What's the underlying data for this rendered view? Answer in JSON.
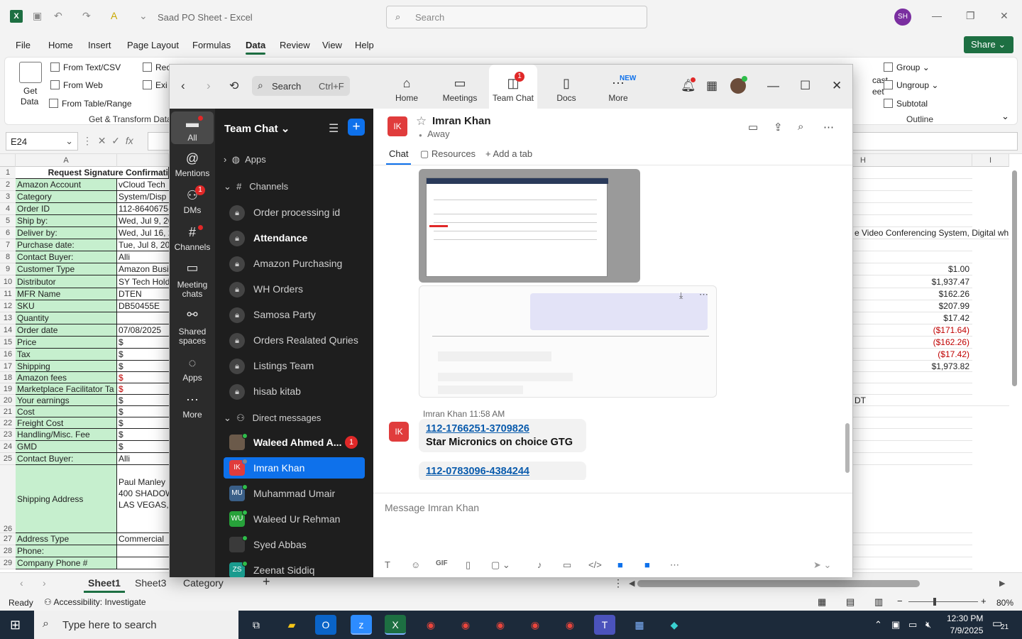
{
  "excel": {
    "title": "Saad PO Sheet  -  Excel",
    "search_placeholder": "Search",
    "user_initials": "SH",
    "menus": [
      "File",
      "Home",
      "Insert",
      "Page Layout",
      "Formulas",
      "Data",
      "Review",
      "View",
      "Help"
    ],
    "active_menu": "Data",
    "share_label": "Share",
    "ribbon": {
      "get_data": "Get",
      "get_data2": "Data",
      "from_text_csv": "From Text/CSV",
      "from_web": "From Web",
      "from_table_range": "From Table/Range",
      "group_label": "Get & Transform Data",
      "rec": "Rec",
      "exi": "Exi",
      "group": "Group",
      "ungroup": "Ungroup",
      "subtotal": "Subtotal",
      "outline": "Outline",
      "cast": "cast",
      "eet": "eet"
    },
    "name_box": "E24",
    "columns": {
      "a": "A",
      "h": "H",
      "i": "I"
    },
    "rows": [
      {
        "n": "1",
        "a": "Request Signature Confirmati",
        "b": "",
        "h": ""
      },
      {
        "n": "2",
        "a": "Amazon Account",
        "b": "vCloud Tech",
        "h": ""
      },
      {
        "n": "3",
        "a": "Category",
        "b": "System/Disp",
        "h": ""
      },
      {
        "n": "4",
        "a": "Order ID",
        "b": "112-8640675-",
        "h": ""
      },
      {
        "n": "5",
        "a": "Ship by:",
        "b": "Wed, Jul 9, 20",
        "h": ""
      },
      {
        "n": "6",
        "a": "Deliver by:",
        "b": "Wed, Jul 16, 2",
        "h": "e Video Conferencing System, Digital wh"
      },
      {
        "n": "7",
        "a": "Purchase date:",
        "b": "Tue, Jul 8, 202",
        "h": ""
      },
      {
        "n": "8",
        "a": "Contact Buyer:",
        "b": "Alli",
        "h": ""
      },
      {
        "n": "9",
        "a": "Customer Type",
        "b": "Amazon Busi",
        "h": "$1.00"
      },
      {
        "n": "10",
        "a": "Distributor",
        "b": "SY Tech Hold",
        "h": "$1,937.47"
      },
      {
        "n": "11",
        "a": "MFR Name",
        "b": "DTEN",
        "h": "$162.26"
      },
      {
        "n": "12",
        "a": "SKU",
        "b": "DB50455E",
        "h": "$207.99"
      },
      {
        "n": "13",
        "a": "Quantity",
        "b": "",
        "h": "$17.42"
      },
      {
        "n": "14",
        "a": "Order date",
        "b": "07/08/2025",
        "h": "($171.64)"
      },
      {
        "n": "15",
        "a": "Price",
        "b": "$",
        "h": "($162.26)"
      },
      {
        "n": "16",
        "a": "Tax",
        "b": "$",
        "h": "($17.42)"
      },
      {
        "n": "17",
        "a": "Shipping",
        "b": "$",
        "h": "$1,973.82"
      },
      {
        "n": "18",
        "a": "Amazon fees",
        "b": "$",
        "h": ""
      },
      {
        "n": "19",
        "a": "Marketplace Facilitator Ta",
        "b": "$",
        "h": ""
      },
      {
        "n": "20",
        "a": "Your earnings",
        "b": "$",
        "h": "DT"
      },
      {
        "n": "21",
        "a": "Cost",
        "b": "$",
        "h": ""
      },
      {
        "n": "22",
        "a": "Freight Cost",
        "b": "$",
        "h": ""
      },
      {
        "n": "23",
        "a": "Handling/Misc. Fee",
        "b": "$",
        "h": ""
      },
      {
        "n": "24",
        "a": "GMD",
        "b": "$",
        "h": ""
      },
      {
        "n": "25",
        "a": "Contact Buyer:",
        "b": "Alli",
        "h": ""
      },
      {
        "n": "26",
        "a": "Shipping Address",
        "b": "Paul Manley\n400 SHADOW\nLAS VEGAS, N",
        "h": ""
      },
      {
        "n": "27",
        "a": "Address Type",
        "b": "Commercial",
        "h": ""
      },
      {
        "n": "28",
        "a": "Phone:",
        "b": "",
        "h": ""
      },
      {
        "n": "29",
        "a": "Company Phone #",
        "b": "",
        "h": ""
      }
    ],
    "sheets": [
      "Sheet1",
      "Sheet3",
      "Category"
    ],
    "active_sheet": "Sheet1",
    "status_ready": "Ready",
    "status_accessibility": "Accessibility: Investigate",
    "zoom_level": "80%"
  },
  "zoom": {
    "search_label": "Search",
    "search_shortcut": "Ctrl+F",
    "tabs": [
      {
        "label": "Home",
        "icon": "home-icon"
      },
      {
        "label": "Meetings",
        "icon": "video-icon"
      },
      {
        "label": "Team Chat",
        "icon": "chat-icon",
        "badge": "1"
      },
      {
        "label": "Docs",
        "icon": "doc-icon"
      },
      {
        "label": "More",
        "icon": "more-icon",
        "badge": "NEW"
      }
    ],
    "rail": [
      {
        "label": "All"
      },
      {
        "label": "Mentions"
      },
      {
        "label": "DMs",
        "badge": "1"
      },
      {
        "label": "Channels"
      },
      {
        "label": "Meeting chats"
      },
      {
        "label": "Shared spaces"
      },
      {
        "label": "Apps"
      },
      {
        "label": "More"
      }
    ],
    "sidebar": {
      "title": "Team Chat",
      "apps": "Apps",
      "channels_header": "Channels",
      "channels": [
        "Order processing id",
        "Attendance",
        "Amazon Purchasing",
        "WH Orders",
        "Samosa Party",
        "Orders Realated Quries",
        "Listings Team",
        "hisab kitab"
      ],
      "bold_channel": "Attendance",
      "dm_header": "Direct messages",
      "dms": [
        {
          "name": "Waleed Ahmed A...",
          "initials": "",
          "color": "#6b5a4a",
          "count": "1",
          "bold": true
        },
        {
          "name": "Imran Khan",
          "initials": "IK",
          "color": "#e03c3c",
          "active": true
        },
        {
          "name": "Muhammad Umair",
          "initials": "MU",
          "color": "#3a5f88"
        },
        {
          "name": "Waleed Ur Rehman",
          "initials": "WU",
          "color": "#27a23a"
        },
        {
          "name": "Syed Abbas",
          "initials": "",
          "color": "#3a3a3a"
        },
        {
          "name": "Zeenat Siddiq",
          "initials": "ZS",
          "color": "#1a9b8e"
        }
      ]
    },
    "chat": {
      "contact_name": "Imran Khan",
      "contact_initials": "IK",
      "status": "Away",
      "tabs": [
        "Chat",
        "Resources",
        "+ Add a tab"
      ],
      "sender": "Imran Khan",
      "time": "11:58 AM",
      "msg1_link": "112-1766251-3709826",
      "msg1_text": "Star Micronics on choice   GTG",
      "msg2_link": "112-0783096-4384244",
      "composer_placeholder": "Message Imran Khan"
    }
  },
  "taskbar": {
    "search_placeholder": "Type here to search",
    "time": "12:30 PM",
    "date": "7/9/2025",
    "notifications": "21"
  }
}
